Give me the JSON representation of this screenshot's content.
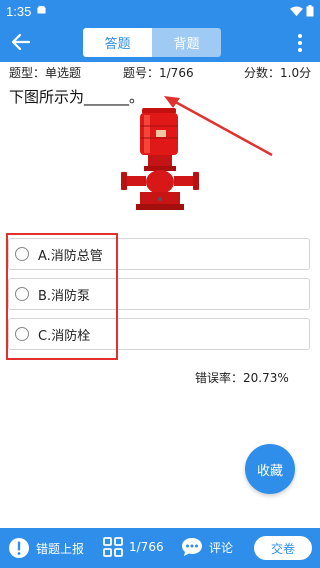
{
  "status_bar": {
    "time": "1:35",
    "icons": [
      "android-icon",
      "wifi-icon",
      "battery-icon"
    ]
  },
  "app_bar": {
    "tabs": [
      {
        "label": "答题",
        "active": true
      },
      {
        "label": "背题",
        "active": false
      }
    ],
    "accent_color": "#2f8ee9"
  },
  "info": {
    "type_label": "题型：单选题",
    "number_label": "题号：1/766",
    "score_label": "分数：1.0分"
  },
  "question": {
    "text": "下图所示为______。"
  },
  "options": [
    {
      "label": "A.消防总管"
    },
    {
      "label": "B.消防泵"
    },
    {
      "label": "C.消防栓"
    }
  ],
  "stats": {
    "error_rate": "错误率：20.73%"
  },
  "fav_button": {
    "label": "收藏"
  },
  "bottom_bar": {
    "report_label": "错题上报",
    "count_label": "1/766",
    "comment_label": "评论",
    "submit_label": "交卷"
  },
  "annotation_color": "#e2302e"
}
